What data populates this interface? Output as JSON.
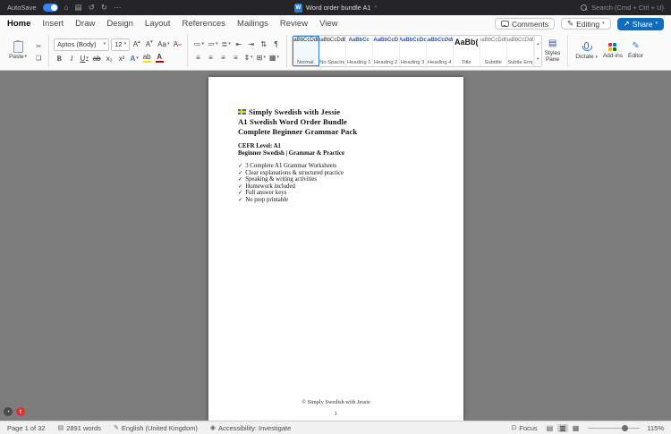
{
  "titlebar": {
    "autosave": "AutoSave",
    "title": "Word order bundle A1",
    "search": "Search (Cmd + Ctrl + U)",
    "badge": "W"
  },
  "glyphs": {
    "home": "⌂",
    "save": "▤",
    "undo": "↺",
    "redo": "↻",
    "more": "⋯",
    "chev": "▾",
    "cut": "✂",
    "copy": "❏",
    "grow": "A",
    "shrink": "A",
    "case": "Aa",
    "clear": "A",
    "bold": "B",
    "italic": "I",
    "underline": "U",
    "strike": "ab",
    "sub": "x₂",
    "sup": "x²",
    "effects": "A",
    "highlight": "ab",
    "fontcolor": "A",
    "bullets": "≔",
    "numbering": "≕",
    "multilist": "≣",
    "outdent": "⇤",
    "indent": "⇥",
    "sort": "⇅",
    "pilcrow": "¶",
    "align": "≡",
    "spacing": "⇕",
    "borders": "⊞",
    "shading": "▦",
    "share": "↗",
    "pencil": "✎",
    "up": "▴",
    "down": "▾",
    "panel": "▤",
    "editor": "✎",
    "focus": "⊡",
    "view1": "▤",
    "view2": "▥",
    "view3": "▦",
    "statusdoc": "▤",
    "person": "◉",
    "warn": "!",
    "clock": "◔"
  },
  "tabs": [
    "Home",
    "Insert",
    "Draw",
    "Design",
    "Layout",
    "References",
    "Mailings",
    "Review",
    "View"
  ],
  "ribbon_right": {
    "comments": "Comments",
    "editing": "Editing",
    "share": "Share"
  },
  "toolbar": {
    "paste": "Paste",
    "font_name": "Aptos (Body)",
    "font_size": "12",
    "styles_pane": [
      "Styles",
      "Pane"
    ],
    "dictate": "Dictate",
    "addins": "Add-ins",
    "editor": "Editor"
  },
  "styles": [
    {
      "p": "AaBbCcDdE",
      "n": "Normal"
    },
    {
      "p": "AaBbCcDdE",
      "n": "No Spacing"
    },
    {
      "p": "AaBbCc",
      "n": "Heading 1"
    },
    {
      "p": "AaBbCcD",
      "n": "Heading 2"
    },
    {
      "p": "AaBbCcDc",
      "n": "Heading 3"
    },
    {
      "p": "AaBbCcDdE",
      "n": "Heading 4"
    },
    {
      "p": "AaBb(",
      "n": "Title"
    },
    {
      "p": "AaBbCcDdE",
      "n": "Subtitle"
    },
    {
      "p": "AaBbCcDdE",
      "n": "Subtle Emph..."
    }
  ],
  "doc": {
    "title1": "Simply Swedish with Jessie",
    "title2": "A1 Swedish Word Order Bundle",
    "title3": "Complete Beginner Grammar Pack",
    "level1": "CEFR Level: A1",
    "level2": "Beginner Swedish | Grammar & Practice",
    "check": "✓",
    "items": [
      "3 Complete A1 Grammar Worksheets",
      "Clear explanations & structured practice",
      "Speaking & writing activities",
      "Homework included",
      "Full answer keys",
      "No prep printable"
    ],
    "footer": "© Simply Swedish with Jessie",
    "page_num": "1"
  },
  "status": {
    "page": "Page 1 of 32",
    "words": "2891 words",
    "language": "English (United Kingdom)",
    "accessibility": "Accessibility: Investigate",
    "focus": "Focus",
    "zoom": "115%"
  }
}
